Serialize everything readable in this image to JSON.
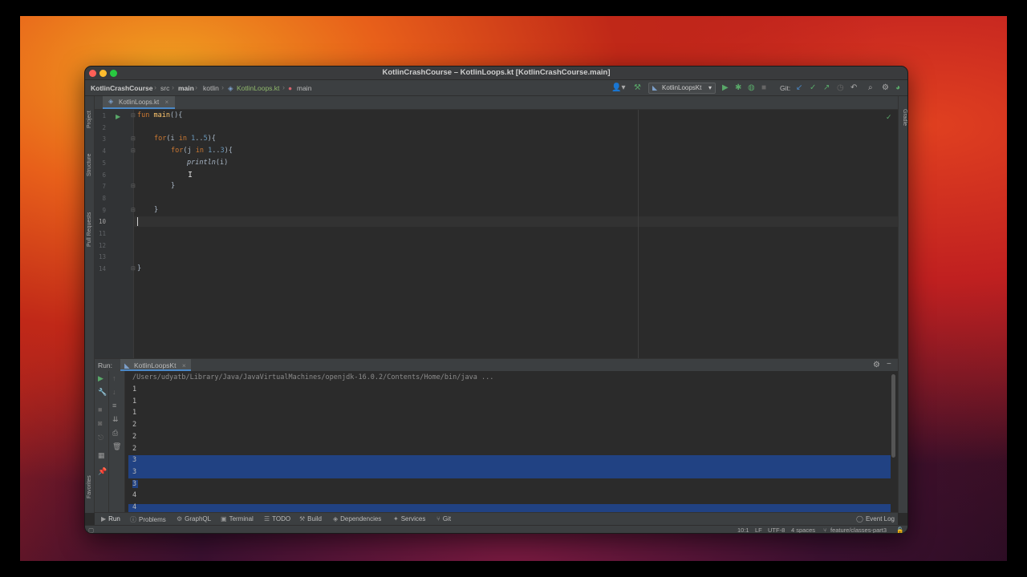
{
  "window": {
    "title": "KotlinCrashCourse – KotlinLoops.kt [KotlinCrashCourse.main]"
  },
  "breadcrumb": {
    "project": "KotlinCrashCourse",
    "src": "src",
    "main": "main",
    "kotlin": "kotlin",
    "file": "KotlinLoops.kt",
    "function": "main"
  },
  "toolbar": {
    "run_config": "KotlinLoopsKt",
    "git_label": "Git:"
  },
  "editor_tab": {
    "label": "KotlinLoops.kt"
  },
  "left_tool_strip": {
    "project": "Project",
    "structure": "Structure",
    "pull_requests": "Pull Requests",
    "favorites": "Favorites"
  },
  "right_tool_strip": {
    "gradle": "Gradle"
  },
  "editor": {
    "line_numbers": [
      "1",
      "2",
      "3",
      "4",
      "5",
      "6",
      "7",
      "8",
      "9",
      "10",
      "11",
      "12",
      "13",
      "14"
    ],
    "lines": [
      {
        "kw": "fun ",
        "fn": "main",
        "rest": "(){"
      },
      {
        "text": ""
      },
      {
        "kw": "for",
        "rest": "(i ",
        "kw2": "in ",
        "n1": "1",
        "op": "..",
        "n2": "5",
        "tail": "){"
      },
      {
        "kw": "for",
        "rest": "(j ",
        "kw2": "in ",
        "n1": "1",
        "op": "..",
        "n2": "3",
        "tail": "){"
      },
      {
        "it": "println",
        "rest": "(i)"
      },
      {
        "text": ""
      },
      {
        "text": "}"
      },
      {
        "text": ""
      },
      {
        "text": "}"
      },
      {
        "text": ""
      },
      {
        "text": ""
      },
      {
        "text": ""
      },
      {
        "text": ""
      },
      {
        "text": "}"
      }
    ]
  },
  "run_panel": {
    "label": "Run:",
    "tab": "KotlinLoopsKt",
    "command": "/Users/udyatb/Library/Java/JavaVirtualMachines/openjdk-16.0.2/Contents/Home/bin/java ...",
    "output": [
      "1",
      "1",
      "1",
      "2",
      "2",
      "2",
      "3",
      "3",
      "3",
      "4",
      "4"
    ]
  },
  "tool_windows": [
    "Run",
    "Problems",
    "GraphQL",
    "Terminal",
    "TODO",
    "Build",
    "Dependencies",
    "Services",
    "Git"
  ],
  "event_log": "Event Log",
  "status_bar": {
    "position": "10:1",
    "line_sep": "LF",
    "encoding": "UTF-8",
    "indent": "4 spaces",
    "branch": "feature/classes-part3"
  },
  "colors": {
    "bg": "#2b2b2b",
    "panel": "#3c3f41",
    "keyword": "#cc7832",
    "function": "#ffc66d",
    "number": "#6897bb",
    "selection": "#214283",
    "run_green": "#59a869"
  }
}
